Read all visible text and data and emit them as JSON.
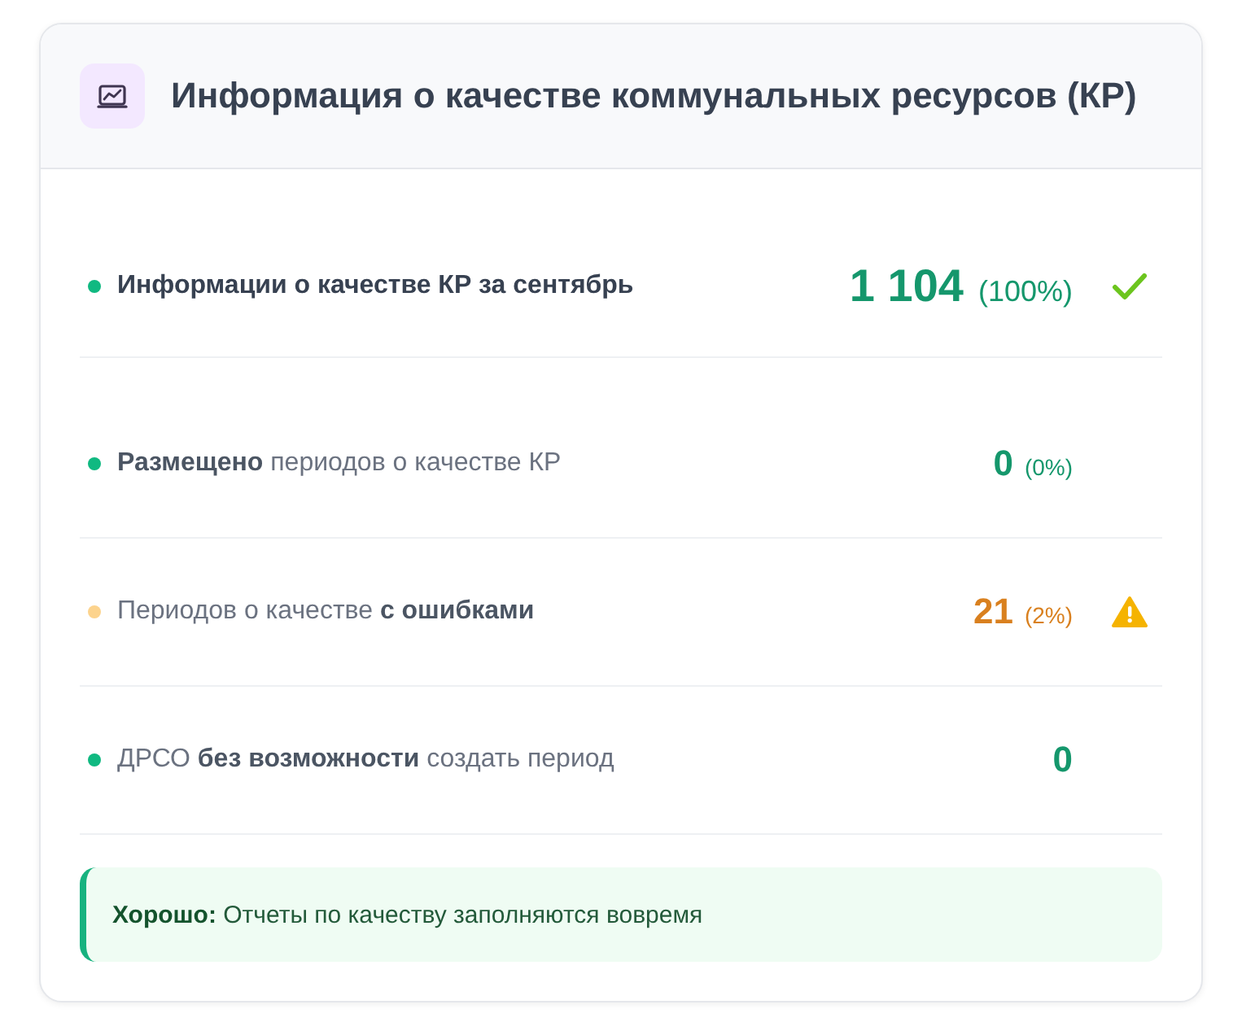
{
  "card": {
    "title": "Информация о качестве коммунальных ресурсов (КР)"
  },
  "rows": [
    {
      "kind": "summary",
      "label": "Информации о качестве КР за сентябрь",
      "color": "#10b981",
      "value": "1 104",
      "percent": "(100%)",
      "verified": true,
      "has_errors": false
    },
    {
      "kind": "metric",
      "label": "**Размещено** периодов о качестве КР",
      "color": "#10b981",
      "value": "0",
      "percent": "(0%)",
      "verified": false,
      "has_errors": false
    },
    {
      "kind": "metric",
      "label": "Периодов о качестве **с ошибками**",
      "color": "#fcd38d",
      "value": "21",
      "percent": "(2%)",
      "verified": false,
      "has_errors": true
    },
    {
      "kind": "metric",
      "label": "ДРСО **без возможности** создать период",
      "color": "#10b981",
      "value": "0",
      "verified": false,
      "has_errors": false
    }
  ],
  "alert": {
    "kind": "success",
    "text": "**Хорошо:** Отчеты по качеству заполняются вовремя"
  }
}
